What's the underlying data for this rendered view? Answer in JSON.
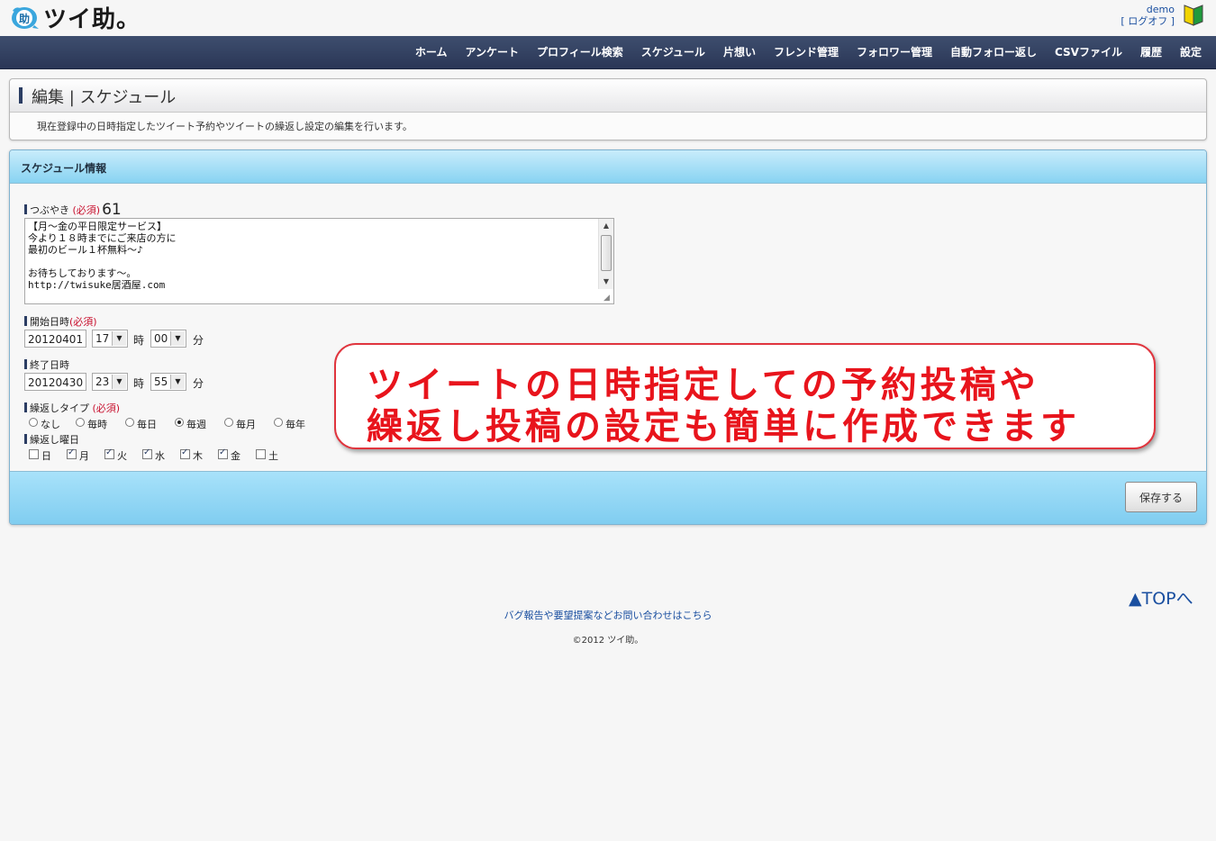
{
  "header": {
    "logo_text": "ツイ助。",
    "user": "demo",
    "logoff": "[ ログオフ ]"
  },
  "nav": {
    "items": [
      "ホーム",
      "アンケート",
      "プロフィール検索",
      "スケジュール",
      "片想い",
      "フレンド管理",
      "フォロワー管理",
      "自動フォロー返し",
      "CSVファイル",
      "履歴",
      "設定"
    ]
  },
  "edit_panel": {
    "title": "編集 | スケジュール",
    "description": "現在登録中の日時指定したツイート予約やツイートの繰返し設定の編集を行います。"
  },
  "schedule": {
    "title": "スケジュール情報",
    "tweet_label": "つぶやき",
    "required": "(必須)",
    "char_count": "61",
    "tweet_text": "【月～金の平日限定サービス】\n今より１８時までにご来店の方に\n最初のビール１杯無料～♪\n\nお待ちしております～。\nhttp://twisuke居酒屋.com",
    "start_label": "開始日時",
    "start_date": "20120401",
    "start_hour": "17",
    "start_min": "00",
    "end_label": "終了日時",
    "end_date": "20120430",
    "end_hour": "23",
    "end_min": "55",
    "hour_unit": "時",
    "min_unit": "分",
    "repeat_type_label": "繰返しタイプ",
    "repeat_types": [
      "なし",
      "毎時",
      "毎日",
      "毎週",
      "毎月",
      "毎年"
    ],
    "repeat_type_selected": "毎週",
    "repeat_days_label": "繰返し曜日",
    "days": [
      "日",
      "月",
      "火",
      "水",
      "木",
      "金",
      "土"
    ],
    "days_checked": [
      "月",
      "火",
      "水",
      "木",
      "金"
    ],
    "save_label": "保存する"
  },
  "callout": {
    "line1": "ツイートの日時指定しての予約投稿や",
    "line2": "繰返し投稿の設定も簡単に作成できます",
    "color": "#e8141c"
  },
  "footer": {
    "totop": "▲TOPへ",
    "contact": "バグ報告や要望提案などお問い合わせはこちら",
    "copyright": "©2012 ツイ助。"
  }
}
